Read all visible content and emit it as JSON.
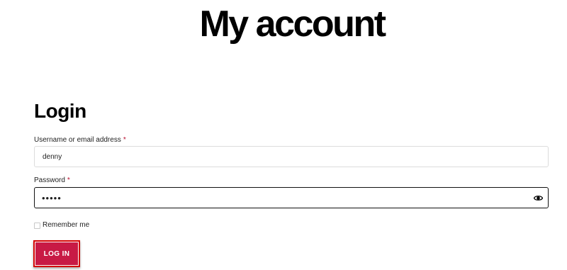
{
  "page": {
    "title": "My account"
  },
  "login": {
    "heading": "Login",
    "username": {
      "label": "Username or email address",
      "required_mark": "*",
      "value": "denny"
    },
    "password": {
      "label": "Password",
      "required_mark": "*",
      "masked_value": "•••••",
      "toggle_icon": "eye-icon"
    },
    "remember": {
      "label": "Remember me",
      "checked": false
    },
    "submit_label": "LOG IN"
  },
  "colors": {
    "button": "#c81a45",
    "required": "#b80d2e",
    "highlight_frame": "#d40000"
  }
}
